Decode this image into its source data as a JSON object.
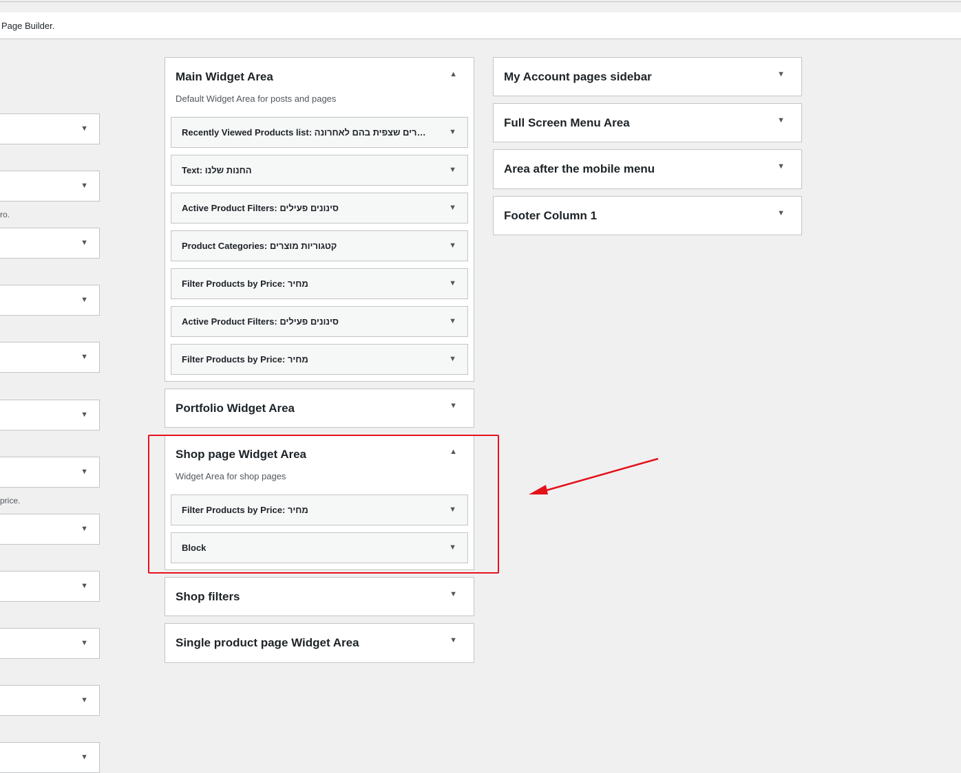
{
  "notice": {
    "text": "Page Builder."
  },
  "left_column": {
    "boxes": [
      "",
      "",
      "",
      "",
      "",
      "",
      "",
      "",
      "",
      "",
      "",
      ""
    ],
    "notes": [
      "ro.",
      "price."
    ]
  },
  "main_area": {
    "title": "Main Widget Area",
    "description": "Default Widget Area for posts and pages",
    "widgets": [
      {
        "name": "Recently Viewed Products list",
        "value": "מוצרים שצפית בהם לאחרונה"
      },
      {
        "name": "Text",
        "value": "החנות שלנו"
      },
      {
        "name": "Active Product Filters",
        "value": "סינונים פעילים"
      },
      {
        "name": "Product Categories",
        "value": "קטגוריות מוצרים"
      },
      {
        "name": "Filter Products by Price",
        "value": "מחיר"
      },
      {
        "name": "Active Product Filters",
        "value": "סינונים פעילים"
      },
      {
        "name": "Filter Products by Price",
        "value": "מחיר"
      }
    ]
  },
  "portfolio_area": {
    "title": "Portfolio Widget Area"
  },
  "shop_area": {
    "title": "Shop page Widget Area",
    "description": "Widget Area for shop pages",
    "widgets": [
      {
        "name": "Filter Products by Price",
        "value": "מחיר"
      },
      {
        "name": "Block",
        "value": ""
      }
    ]
  },
  "shop_filters_area": {
    "title": "Shop filters"
  },
  "single_product_area": {
    "title": "Single product page Widget Area"
  },
  "right_areas": [
    {
      "title": "My Account pages sidebar"
    },
    {
      "title": "Full Screen Menu Area"
    },
    {
      "title": "Area after the mobile menu"
    },
    {
      "title": "Footer Column 1"
    }
  ],
  "annotation": {
    "highlight_color": "#e4111b"
  },
  "icons": {
    "collapse": "triangle-up-icon",
    "expand": "triangle-down-icon"
  }
}
